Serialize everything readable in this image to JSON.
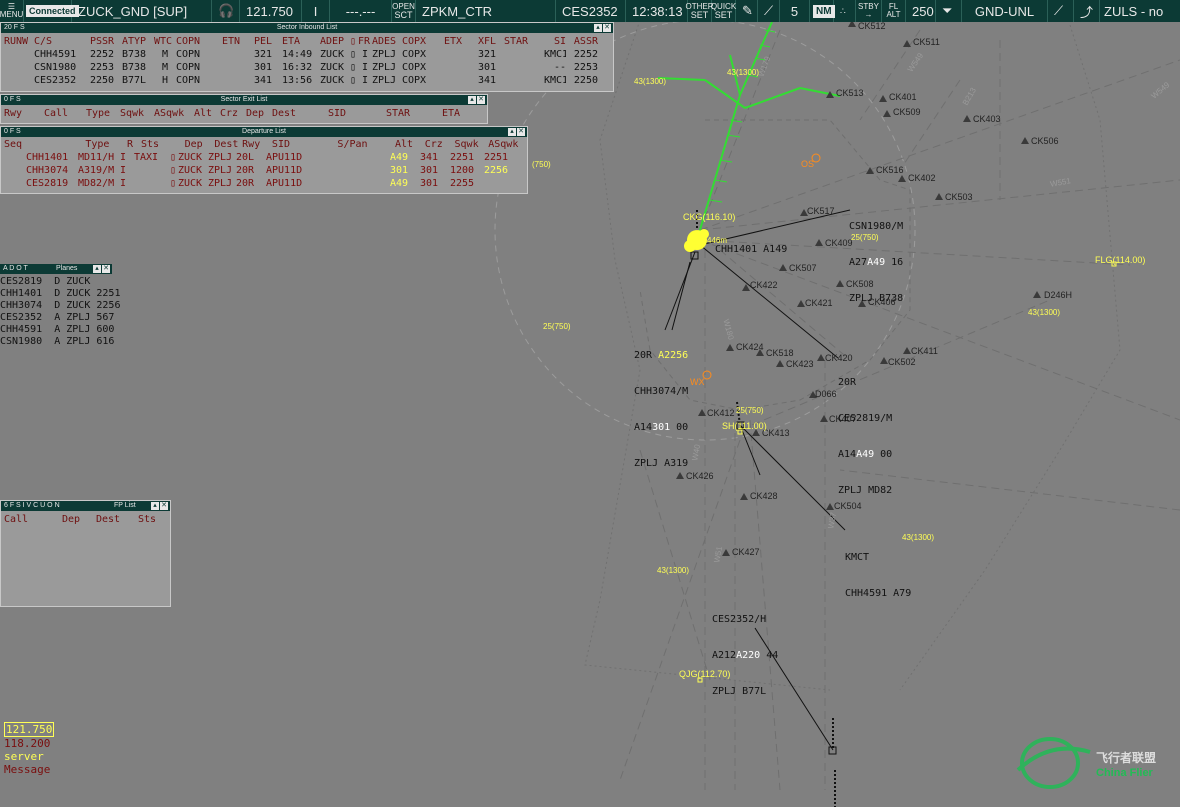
{
  "topbar": {
    "menu_label": "MENU",
    "connection_status": "Connected",
    "position": "ZUCK_GND [SUP]",
    "active_freq": "121.750",
    "separator": "I",
    "secondary_freq": "---.---",
    "open_label_top": "OPEN",
    "open_label_bottom": "SCT",
    "open_sector": "ZPKM_CTR",
    "selected_callsign": "CES2352",
    "utc_time": "12:38:13",
    "other_set_top": "OTHER",
    "other_set_bottom": "SET",
    "quick_set_top": "QUICK",
    "quick_set_bottom": "SET",
    "range_value": "5",
    "range_unit": "NM",
    "stby_top": "STBY",
    "fl_top": "FL",
    "fl_bottom": "ALT",
    "altitude_value": "250",
    "filter_label": "GND-UNL",
    "sector_right": "ZULS - no"
  },
  "inbound": {
    "title_prefix": "20 F S",
    "title": "Sector Inbound List",
    "headers": [
      "RUNW",
      "C/S",
      "PSSR",
      "ATYP",
      "WTC",
      "COPN",
      "ETN",
      "PEL",
      "ETA",
      "ADEP",
      "",
      "FR",
      "ADES",
      "COPX",
      "ETX",
      "XFL",
      "STAR",
      "SI",
      "ASSR"
    ],
    "rows": [
      {
        "callsign": "CHH4591",
        "pssr": "2252",
        "atyp": "B738",
        "wtc": "M",
        "copn": "COPN",
        "pel": "321",
        "eta": "14:49",
        "adep": "ZUCK",
        "fr": "I",
        "ades": "ZPLJ",
        "copx": "COPX",
        "xfl": "321",
        "si": "KMC1",
        "assr": "2252"
      },
      {
        "callsign": "CSN1980",
        "pssr": "2253",
        "atyp": "B738",
        "wtc": "M",
        "copn": "COPN",
        "pel": "301",
        "eta": "16:32",
        "adep": "ZUCK",
        "fr": "I",
        "ades": "ZPLJ",
        "copx": "COPX",
        "xfl": "301",
        "si": "--",
        "assr": "2253"
      },
      {
        "callsign": "CES2352",
        "pssr": "2250",
        "atyp": "B77L",
        "wtc": "H",
        "copn": "COPN",
        "pel": "341",
        "eta": "13:56",
        "adep": "ZUCK",
        "fr": "I",
        "ades": "ZPLJ",
        "copx": "COPX",
        "xfl": "341",
        "si": "KMC1",
        "assr": "2250"
      }
    ]
  },
  "exit": {
    "title_prefix": "0 F S",
    "title": "Sector Exit List",
    "headers": [
      "Rwy",
      "Call",
      "Type",
      "Sqwk",
      "ASqwk",
      "Alt",
      "Crz",
      "Dep",
      "Dest",
      "SID",
      "STAR",
      "ETA"
    ]
  },
  "departure": {
    "title_prefix": "0 F S",
    "title": "Departure List",
    "headers": [
      "Seq",
      "Type",
      "R",
      "Sts",
      "Dep",
      "Dest",
      "Rwy",
      "SID",
      "S/Pan",
      "Alt",
      "Crz",
      "Sqwk",
      "ASqwk"
    ],
    "rows": [
      {
        "callsign": "CHH1401",
        "type": "MD11/H",
        "r": "I",
        "sts": "TAXI",
        "dep": "ZUCK",
        "dest": "ZPLJ",
        "rwy": "20L",
        "sid": "APU11D",
        "alt": "A49",
        "crz": "341",
        "sqwk": "2251",
        "asqwk": "2251"
      },
      {
        "callsign": "CHH3074",
        "type": "A319/M",
        "r": "I",
        "sts": "",
        "dep": "ZUCK",
        "dest": "ZPLJ",
        "rwy": "20R",
        "sid": "APU11D",
        "alt": "301",
        "crz": "301",
        "sqwk": "1200",
        "asqwk": "2256"
      },
      {
        "callsign": "CES2819",
        "type": "MD82/M",
        "r": "I",
        "sts": "",
        "dep": "ZUCK",
        "dest": "ZPLJ",
        "rwy": "20R",
        "sid": "APU11D",
        "alt": "A49",
        "crz": "301",
        "sqwk": "2255",
        "asqwk": ""
      }
    ]
  },
  "planes": {
    "title_prefix": "A D O T",
    "title": "Planes",
    "rows": [
      {
        "callsign": "CES2819",
        "dir": "D",
        "airport": "ZUCK",
        "code": ""
      },
      {
        "callsign": "CHH1401",
        "dir": "D",
        "airport": "ZUCK",
        "code": "2251"
      },
      {
        "callsign": "CHH3074",
        "dir": "D",
        "airport": "ZUCK",
        "code": "2256"
      },
      {
        "callsign": "CES2352",
        "dir": "A",
        "airport": "ZPLJ",
        "code": "567"
      },
      {
        "callsign": "CHH4591",
        "dir": "A",
        "airport": "ZPLJ",
        "code": "600"
      },
      {
        "callsign": "CSN1980",
        "dir": "A",
        "airport": "ZPLJ",
        "code": "616"
      }
    ]
  },
  "fplist": {
    "title_prefix": "6 F S I V C U O N",
    "title": "FP List",
    "headers": [
      "Call",
      "Dep",
      "Dest",
      "Sts"
    ]
  },
  "tags": {
    "csn1980": {
      "l1": "CSN1980/M",
      "l2a": "A27",
      "l2b": "A49",
      "l2c": " 16",
      "l3": "ZPLJ B738"
    },
    "chh1401": {
      "l1": "CHH1401 A149"
    },
    "chh3074": {
      "l0a": "20R ",
      "l0b": "A2256",
      "l1": "CHH3074/M",
      "l2a": "A14",
      "l2b": "301",
      "l2c": " 00",
      "l3": "ZPLJ A319"
    },
    "ces2819": {
      "l0": "20R",
      "l1": "CES2819/M",
      "l2a": "A14",
      "l2b": "A49",
      "l2c": " 00",
      "l3": "ZPLJ MD82"
    },
    "chh4591": {
      "l1": "KMCT",
      "l2": "CHH4591 A79"
    },
    "ces2352": {
      "l1": "CES2352/H",
      "l2a": "A212",
      "l2b": "A220",
      "l2c": " 44",
      "l3": "ZPLJ B77L"
    }
  },
  "fixes": [
    "CK512",
    "CK511",
    "CK513",
    "CK401",
    "CK509",
    "CK403",
    "CK506",
    "CK516",
    "CK402",
    "CK503",
    "CK517",
    "CK409",
    "CK507",
    "CK508",
    "CK422",
    "CK421",
    "CK406",
    "CK424",
    "CK518",
    "CK423",
    "CK420",
    "CK502",
    "CK411",
    "D066",
    "CK407",
    "CK412",
    "CK413",
    "CK426",
    "CK428",
    "CK504",
    "CK427",
    "D246H"
  ],
  "navaids": {
    "ckg": "CKG(116.10)",
    "flg": "FLG(114.00)",
    "sh": "SH(111.00)",
    "qjg": "QJG(112.70)"
  },
  "airways": [
    "W549",
    "W179",
    "B213",
    "W551",
    "W180",
    "W40",
    "W51",
    "W37",
    "W549"
  ],
  "alt_labels": [
    "43(1300)",
    "43(1300)",
    "(750)",
    "25(750)",
    "25(750)",
    "25(750)",
    "43(1300)",
    "43(1300)",
    "43(1300)"
  ],
  "weather": {
    "os": "OS",
    "wx": "WX"
  },
  "ownship_alt": "446m",
  "frequencies": {
    "active": "121.750",
    "standby": "118.200",
    "server_label": "server",
    "message_label": "Message"
  },
  "watermark": {
    "cn": "飞行者联盟",
    "en": "China Flier"
  },
  "colors": {
    "bar": "#0c3a35",
    "scope": "#808080",
    "route": "#33dd33",
    "label_yellow": "#ffff55",
    "alert": "#ff8c1a",
    "red_text": "#7a0e0e"
  }
}
